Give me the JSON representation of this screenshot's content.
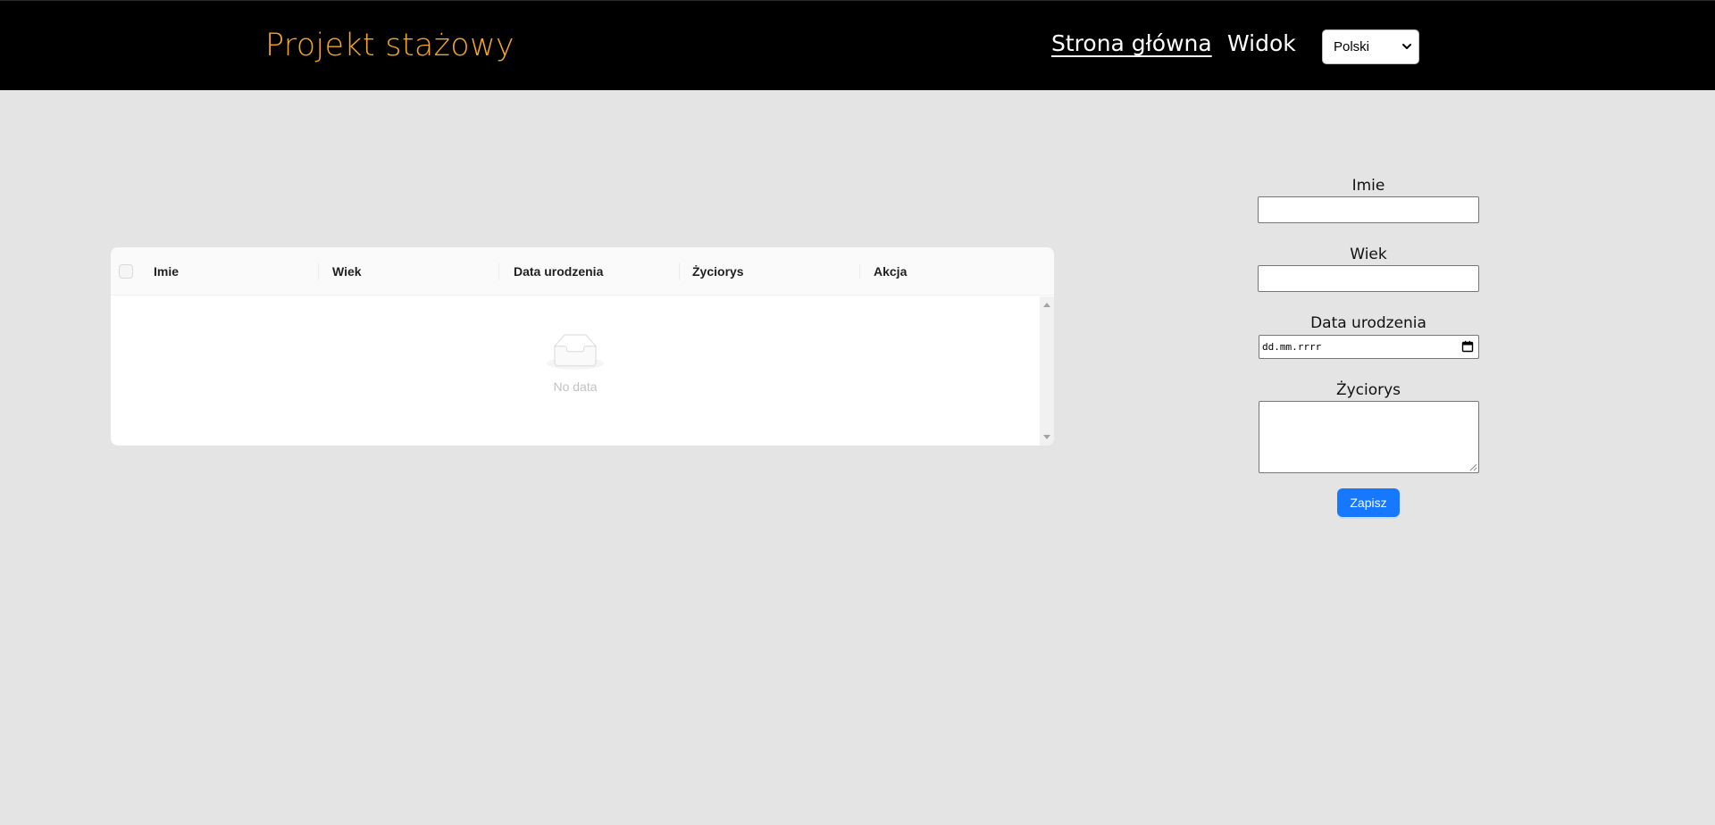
{
  "header": {
    "brand": "Projekt stażowy",
    "nav": {
      "home": "Strona główna",
      "view": "Widok"
    },
    "language": {
      "selected": "Polski"
    },
    "colors": {
      "background": "#000000",
      "brand": "#f5a623",
      "link": "#ffffff"
    }
  },
  "table": {
    "columns": [
      "Imie",
      "Wiek",
      "Data urodzenia",
      "Życiorys",
      "Akcja"
    ],
    "empty_text": "No data",
    "empty_icon": "inbox-icon",
    "rows": []
  },
  "form": {
    "name_label": "Imie",
    "age_label": "Wiek",
    "birthdate_label": "Data urodzenia",
    "birthdate_placeholder": "dd.mm.rrrr",
    "bio_label": "Życiorys",
    "submit_label": "Zapisz",
    "colors": {
      "primary": "#1677ff"
    }
  }
}
